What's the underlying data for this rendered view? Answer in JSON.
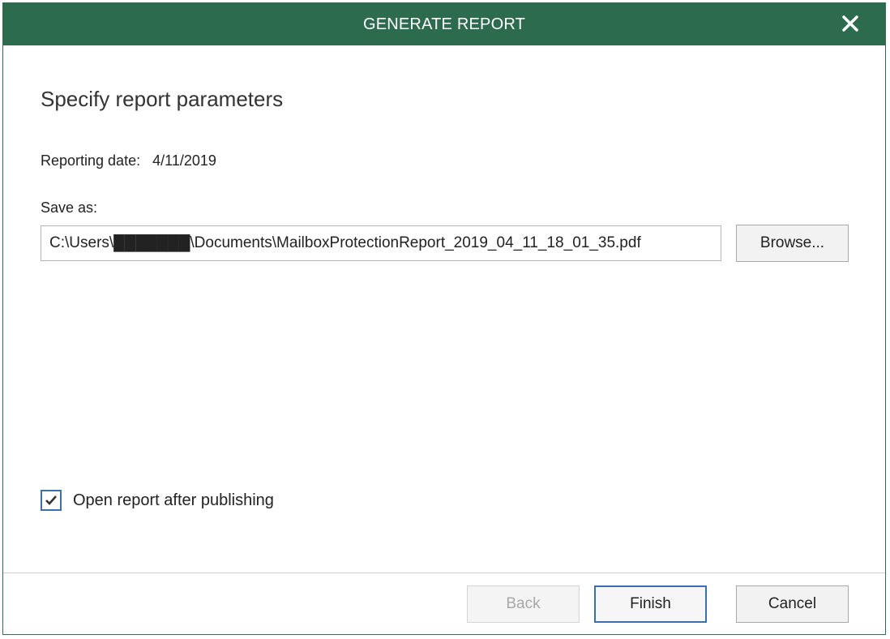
{
  "window": {
    "title": "GENERATE REPORT",
    "close_icon": "close-icon",
    "titlebar_color": "#2d6b4f"
  },
  "main": {
    "heading": "Specify report parameters",
    "reporting_date_label": "Reporting date:",
    "reporting_date_value": "4/11/2019",
    "save_as_label": "Save as:",
    "save_as_value": "C:\\Users\\███████\\Documents\\MailboxProtectionReport_2019_04_11_18_01_35.pdf",
    "browse_label": "Browse...",
    "open_after_label": "Open report after publishing",
    "open_after_checked": true
  },
  "footer": {
    "back_label": "Back",
    "finish_label": "Finish",
    "cancel_label": "Cancel"
  },
  "colors": {
    "accent": "#3a6fb0",
    "disabled_text": "#a8a8a8"
  }
}
